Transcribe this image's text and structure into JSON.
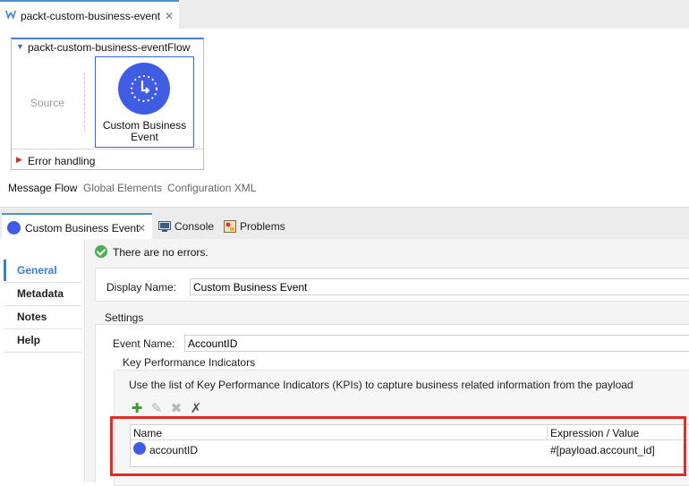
{
  "editor": {
    "tab_title": "packt-custom-business-event"
  },
  "flow": {
    "name": "packt-custom-business-eventFlow",
    "source_label": "Source",
    "processor_label": "Custom Business Event",
    "error_handling": "Error handling"
  },
  "view_tabs": [
    {
      "label": "Message Flow",
      "active": true
    },
    {
      "label": "Global Elements",
      "active": false
    },
    {
      "label": "Configuration XML",
      "active": false
    }
  ],
  "panel_tabs": {
    "active": "Custom Business Event",
    "console": "Console",
    "problems": "Problems"
  },
  "side_nav": [
    "General",
    "Metadata",
    "Notes",
    "Help"
  ],
  "form": {
    "status": "There are no errors.",
    "display_name_label": "Display Name:",
    "display_name_value": "Custom Business Event",
    "settings_title": "Settings",
    "event_name_label": "Event Name:",
    "event_name_value": "AccountID",
    "kpi_title": "Key Performance Indicators",
    "kpi_description": "Use the list of Key Performance Indicators (KPIs) to capture business related information from the payload",
    "table": {
      "columns": [
        "Name",
        "Expression / Value"
      ],
      "rows": [
        {
          "name": "accountID",
          "expression": "#[payload.account_id]"
        }
      ]
    }
  },
  "colors": {
    "accent_blue": "#3a7dc9",
    "icon_blue": "#3f5ce3",
    "highlight_red": "#e12b24",
    "ok_green": "#4caf50"
  }
}
